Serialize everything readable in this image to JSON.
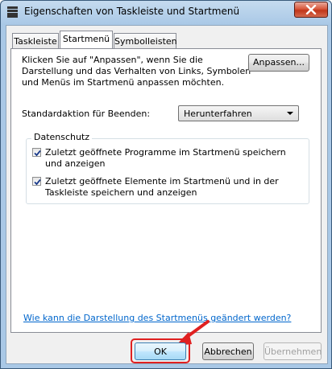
{
  "window": {
    "title": "Eigenschaften von Taskleiste und Startmenü"
  },
  "tabs": [
    {
      "label": "Taskleiste"
    },
    {
      "label": "Startmenü"
    },
    {
      "label": "Symbolleisten"
    }
  ],
  "startmenu": {
    "description": "Klicken Sie auf \"Anpassen\", wenn Sie die Darstellung und das Verhalten von Links, Symbolen und Menüs im Startmenü anpassen möchten.",
    "customize_label": "Anpassen...",
    "power_label": "Standardaktion für Beenden:",
    "power_value": "Herunterfahren",
    "privacy_title": "Datenschutz",
    "privacy_items": [
      {
        "label": "Zuletzt geöffnete Programme im Startmenü speichern und anzeigen",
        "checked": true
      },
      {
        "label": "Zuletzt geöffnete Elemente im Startmenü und in der Taskleiste speichern und anzeigen",
        "checked": true
      }
    ],
    "help_link": "Wie kann die Darstellung des Startmenüs geändert werden?"
  },
  "buttons": {
    "ok": "OK",
    "cancel": "Abbrechen",
    "apply": "Übernehmen"
  },
  "colors": {
    "highlight": "#e02020",
    "link": "#0066cc"
  }
}
